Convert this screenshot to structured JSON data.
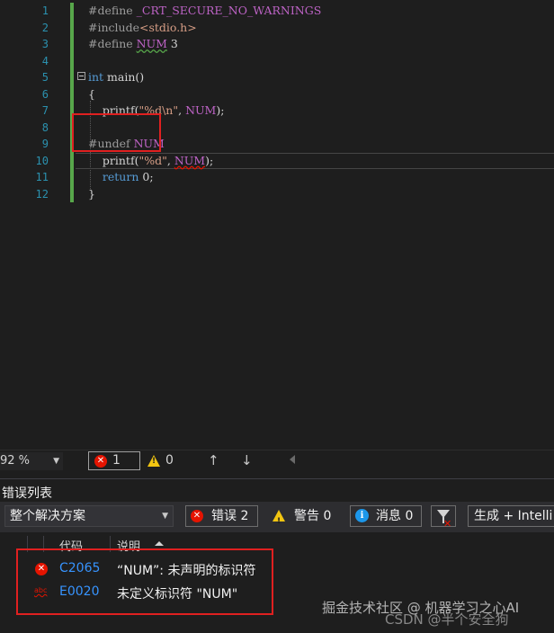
{
  "editor": {
    "line_numbers": [
      "1",
      "2",
      "3",
      "4",
      "5",
      "6",
      "7",
      "8",
      "9",
      "10",
      "11",
      "12"
    ],
    "lines": {
      "l1": {
        "pre": "#define ",
        "name": "_CRT_SECURE_NO_WARNINGS"
      },
      "l2": {
        "pre": "#include",
        "header": "<stdio.h>"
      },
      "l3": {
        "pre": "#define ",
        "macro": "NUM",
        "value": " 3"
      },
      "l5": {
        "type": "int",
        "fn": " main()"
      },
      "l6": {
        "text": "{"
      },
      "l7": {
        "call": "printf(",
        "str": "\"%d\\n\"",
        "args": ", ",
        "macro": "NUM",
        "tail": ");"
      },
      "l9": {
        "pre": "#undef ",
        "macro": "NUM"
      },
      "l10": {
        "call": "printf(",
        "str": "\"%d\"",
        "args": ", ",
        "macro": "NUM",
        "tail": ");"
      },
      "l11": {
        "kw": "return",
        "tail": " 0;"
      },
      "l12": {
        "text": "}"
      }
    }
  },
  "status": {
    "zoom": "92 %",
    "error_count": "1",
    "warning_count": "0"
  },
  "error_list": {
    "title": "错误列表",
    "scope": "整个解决方案",
    "errors_label": "错误 2",
    "warnings_label": "警告 0",
    "messages_label": "消息 0",
    "build_label": "生成 + Intelli",
    "columns": {
      "code": "代码",
      "description": "说明"
    },
    "rows": [
      {
        "code": "C2065",
        "description": "“NUM”: 未声明的标识符",
        "icon": "error-icon"
      },
      {
        "code": "E0020",
        "description": "未定义标识符 \"NUM\"",
        "icon": "abc-icon"
      }
    ]
  },
  "watermark": {
    "line1": "掘金技术社区 @ 机器学习之心AI",
    "line2": "CSDN @半个安全狗"
  },
  "colors": {
    "background": "#1e1e1e",
    "line_number": "#2b91af",
    "keyword": "#569cd6",
    "macro": "#bd63c5",
    "string": "#d69d85",
    "change_bar": "#57a64a",
    "highlight_box": "#e02020",
    "link": "#3794ff"
  }
}
